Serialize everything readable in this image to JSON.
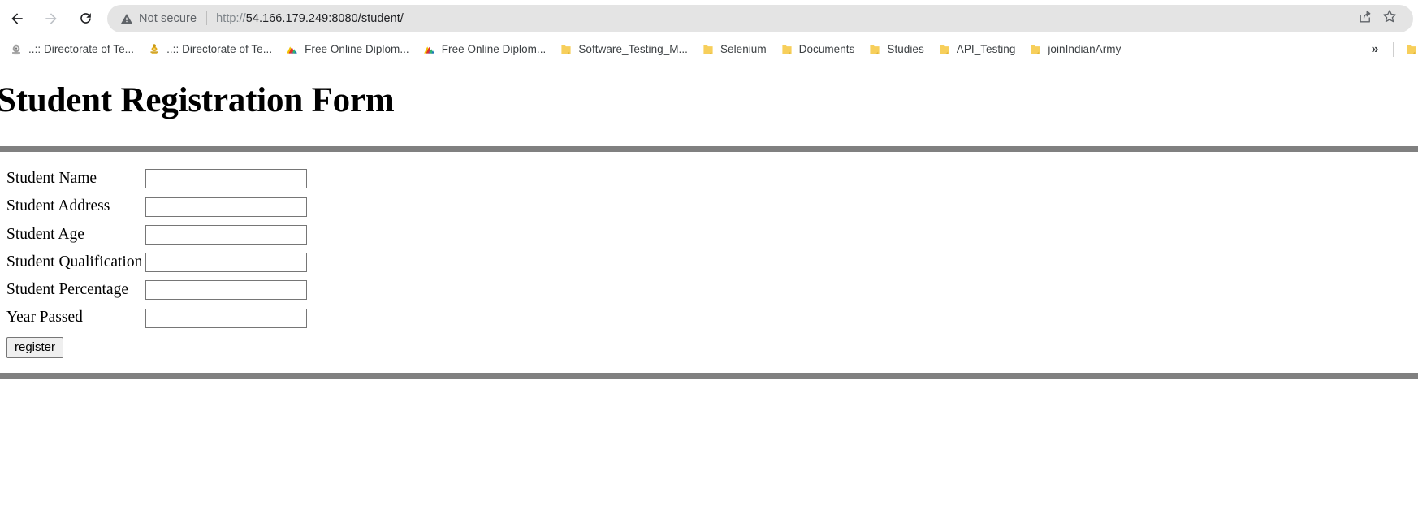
{
  "browser": {
    "nav": {
      "back_label": "Back",
      "back_icon": "arrow-left-icon",
      "back_enabled": true,
      "forward_label": "Forward",
      "forward_icon": "arrow-right-icon",
      "forward_enabled": false,
      "reload_label": "Reload",
      "reload_icon": "reload-icon"
    },
    "omnibox": {
      "security_status": "Not secure",
      "security_icon": "warning-triangle-icon",
      "url_scheme": "http://",
      "url_rest": "54.166.179.249:8080/student/",
      "url_full": "http://54.166.179.249:8080/student/",
      "share_icon": "share-icon",
      "bookmark_icon": "star-icon"
    },
    "bookmarks": {
      "overflow_label": "»",
      "items": [
        {
          "label": "..:: Directorate of Te...",
          "icon": "emblem-favicon"
        },
        {
          "label": "..:: Directorate of Te...",
          "icon": "emblem-gold-favicon"
        },
        {
          "label": "Free Online Diplom...",
          "icon": "alison-favicon"
        },
        {
          "label": "Free Online Diplom...",
          "icon": "alison-favicon"
        },
        {
          "label": "Software_Testing_M...",
          "icon": "folder-icon"
        },
        {
          "label": "Selenium",
          "icon": "folder-icon"
        },
        {
          "label": "Documents",
          "icon": "folder-icon"
        },
        {
          "label": "Studies",
          "icon": "folder-icon"
        },
        {
          "label": "API_Testing",
          "icon": "folder-icon"
        },
        {
          "label": "joinIndianArmy",
          "icon": "folder-icon"
        }
      ]
    }
  },
  "page": {
    "title": "Student Registration Form",
    "fields": [
      {
        "label": "Student Name",
        "value": "",
        "placeholder": ""
      },
      {
        "label": "Student Address",
        "value": "",
        "placeholder": ""
      },
      {
        "label": "Student Age",
        "value": "",
        "placeholder": ""
      },
      {
        "label": "Student Qualification",
        "value": "",
        "placeholder": ""
      },
      {
        "label": "Student Percentage",
        "value": "",
        "placeholder": ""
      },
      {
        "label": "Year Passed",
        "value": "",
        "placeholder": ""
      }
    ],
    "submit_label": "register"
  },
  "colors": {
    "rule_gray": "#808080",
    "omnibox_bg": "#e4e4e4",
    "folder_yellow": "#f7cf5b",
    "text_dark": "#202124",
    "text_muted": "#5f6368"
  }
}
